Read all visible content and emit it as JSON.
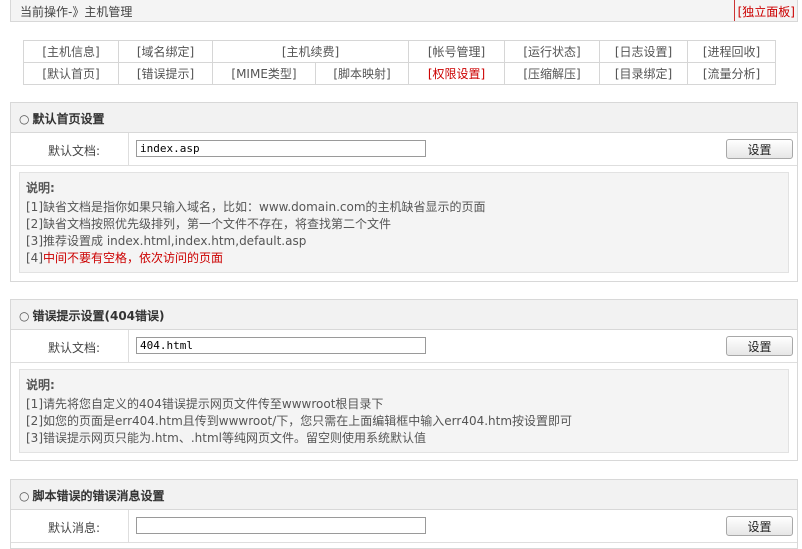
{
  "topbar": {
    "crumb": "当前操作-》主机管理",
    "panel_link": "[独立面板]"
  },
  "tabs": {
    "row1": [
      "[主机信息]",
      "[域名绑定]",
      "[主机续费]",
      "[帐号管理]",
      "[运行状态]",
      "[日志设置]",
      "[进程回收]"
    ],
    "row2": [
      "[默认首页]",
      "[错误提示]",
      "[MIME类型]",
      "[脚本映射]",
      "[权限设置]",
      "[压缩解压]",
      "[目录绑定]",
      "[流量分析]"
    ]
  },
  "section1": {
    "title": "默认首页设置",
    "label": "默认文档:",
    "value": "index.asp",
    "button": "设置",
    "notes_title": "说明:",
    "notes": [
      "[1]缺省文档是指你如果只输入域名，比如：www.domain.com的主机缺省显示的页面",
      "[2]缺省文档按照优先级排列，第一个文件不存在，将查找第二个文件",
      "[3]推荐设置成  index.html,index.htm,default.asp"
    ],
    "note4_prefix": "[4]",
    "note4_text": "中间不要有空格，依次访问的页面"
  },
  "section2": {
    "title": "错误提示设置(404错误)",
    "label": "默认文档:",
    "value": "404.html",
    "button": "设置",
    "notes_title": "说明:",
    "notes": [
      "[1]请先将您自定义的404错误提示网页文件传至wwwroot根目录下",
      "[2]如您的页面是err404.htm且传到wwwroot/下，您只需在上面编辑框中输入err404.htm按设置即可",
      "[3]错误提示网页只能为.htm、.html等纯网页文件。留空则使用系统默认值"
    ]
  },
  "section3": {
    "title": "脚本错误的错误消息设置",
    "label": "默认消息:",
    "value": "",
    "button": "设置"
  },
  "icons": {
    "section_marker": "circle-icon"
  },
  "colors": {
    "accent_red": "#cc0000"
  }
}
